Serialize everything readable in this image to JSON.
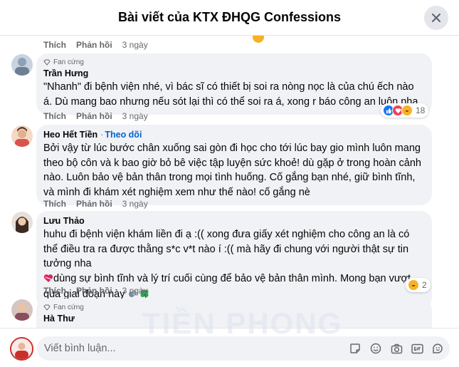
{
  "header": {
    "title": "Bài viết của KTX ĐHQG Confessions"
  },
  "actions": {
    "like": "Thích",
    "reply": "Phản hồi"
  },
  "top_meta": {
    "time": "3 ngày"
  },
  "comments": [
    {
      "badge": "Fan cứng",
      "author": "Trần Hưng",
      "text": "\"Nhanh\" đi bệnh viện nhé, vì bác sĩ có thiết bị soi ra nòng nọc là của chú ếch nào á. Dù mang bao nhưng nếu sót lại thì có thể soi ra á, xong r báo công an luôn nha",
      "time": "3 ngày",
      "reactions_count": "18"
    },
    {
      "author": "Heo Hết Tiền",
      "separator": "·",
      "follow": "Theo dõi",
      "text": "Bởi vậy từ lúc bước chân xuống sai gòn đi học cho tới lúc bay gio mình luôn mang theo bộ côn và k bao giờ bỏ bê việc tập luyện sức khoẻ! dù gặp ở trong hoàn cảnh nào. Luôn bảo vệ bản thân trong mọi tình huống. Cố gắng bạn nhé, giữ bình tĩnh, và mình đi khám xét nghiệm xem như thế nào! cố gắng nè",
      "time": "3 ngày"
    },
    {
      "author": "Lưu Thảo",
      "text_part1": "huhu đi bệnh viện khám liền đi ạ :(( xong đưa giấy xét nghiệm cho công an là có thể điều tra ra được thằng s*c v*t nào í :(( mà hãy đi chung với người thật sự tin tưởng nha",
      "text_part2": "dùng sự bình tĩnh và lý trí cuối cùng để bảo vệ bản thân mình. Mong bạn vượt qua giai đoạn này",
      "time": "3 ngày",
      "reactions_count": "2"
    },
    {
      "badge": "Fan cứng",
      "author": "Hà Thư"
    }
  ],
  "composer": {
    "placeholder": "Viết bình luận..."
  },
  "watermark": "TIỀN PHONG",
  "colors": {
    "accent": "#0064d1",
    "bubble": "#f0f2f5",
    "meta": "#65676b",
    "like": "#1877f2",
    "love": "#f33e58",
    "haha": "#f7b125"
  },
  "icons": [
    "close-icon",
    "diamond-badge-icon",
    "like-reaction-icon",
    "love-reaction-icon",
    "haha-reaction-icon",
    "heart-emoji-icon",
    "clover-emoji-icon",
    "sticker-icon",
    "emoji-icon",
    "camera-icon",
    "gif-icon",
    "sticker-smile-icon"
  ]
}
